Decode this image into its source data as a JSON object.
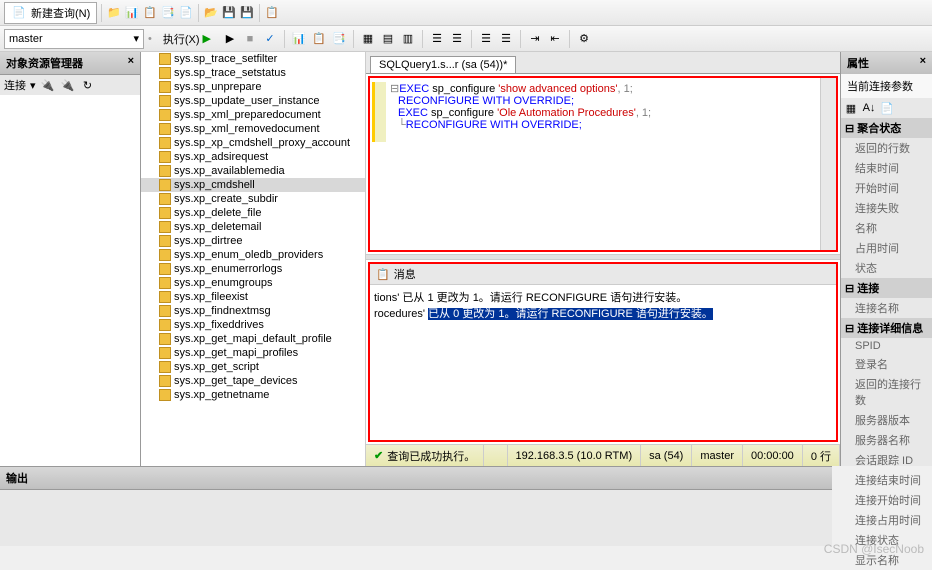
{
  "toolbar": {
    "new_query": "新建查询(N)",
    "db_selected": "master",
    "execute": "执行(X)"
  },
  "left": {
    "title": "对象资源管理器",
    "connect": "连接"
  },
  "tree": [
    "sys.sp_trace_setfilter",
    "sys.sp_trace_setstatus",
    "sys.sp_unprepare",
    "sys.sp_update_user_instance",
    "sys.sp_xml_preparedocument",
    "sys.sp_xml_removedocument",
    "sys.sp_xp_cmdshell_proxy_account",
    "sys.xp_adsirequest",
    "sys.xp_availablemedia",
    "sys.xp_cmdshell",
    "sys.xp_create_subdir",
    "sys.xp_delete_file",
    "sys.xp_deletemail",
    "sys.xp_dirtree",
    "sys.xp_enum_oledb_providers",
    "sys.xp_enumerrorlogs",
    "sys.xp_enumgroups",
    "sys.xp_fileexist",
    "sys.xp_findnextmsg",
    "sys.xp_fixeddrives",
    "sys.xp_get_mapi_default_profile",
    "sys.xp_get_mapi_profiles",
    "sys.xp_get_script",
    "sys.xp_get_tape_devices",
    "sys.xp_getnetname"
  ],
  "tree_selected_index": 9,
  "tab": {
    "label": "SQLQuery1.s...r (sa (54))*"
  },
  "sql": {
    "l1a": "EXEC",
    "l1b": " sp_configure ",
    "l1c": "'show advanced options'",
    "l1d": ", 1;",
    "l2": "RECONFIGURE WITH OVERRIDE;",
    "l3a": "EXEC",
    "l3b": " sp_configure ",
    "l3c": "'Ole Automation Procedures'",
    "l3d": ", 1;",
    "l4": "RECONFIGURE WITH OVERRIDE;"
  },
  "messages": {
    "tab": "消息",
    "line1a": "tions' ",
    "line1b": "已从 1 更改为 1。请运行 RECONFIGURE 语句进行安装。",
    "line2a": "rocedures' ",
    "line2b": "已从 0 更改为 1。请运行 RECONFIGURE 语句进行安装。"
  },
  "status": {
    "success": "查询已成功执行。",
    "server": "192.168.3.5 (10.0 RTM)",
    "user": "sa (54)",
    "db": "master",
    "time": "00:00:00",
    "rows": "0 行"
  },
  "props": {
    "title": "属性",
    "sub": "当前连接参数",
    "cat1": "聚合状态",
    "i1": "返回的行数",
    "i2": "结束时间",
    "i3": "开始时间",
    "i4": "连接失败",
    "i5": "名称",
    "i6": "占用时间",
    "i7": "状态",
    "cat2": "连接",
    "i8": "连接名称",
    "cat3": "连接详细信息",
    "i9": "SPID",
    "i10": "登录名",
    "i11": "返回的连接行数",
    "i12": "服务器版本",
    "i13": "服务器名称",
    "i14": "会话跟踪 ID",
    "i15": "连接结束时间",
    "i16": "连接开始时间",
    "i17": "连接占用时间",
    "i18": "连接状态",
    "i19": "显示名称"
  },
  "output": {
    "title": "输出"
  },
  "watermark": "CSDN @IsecNoob"
}
